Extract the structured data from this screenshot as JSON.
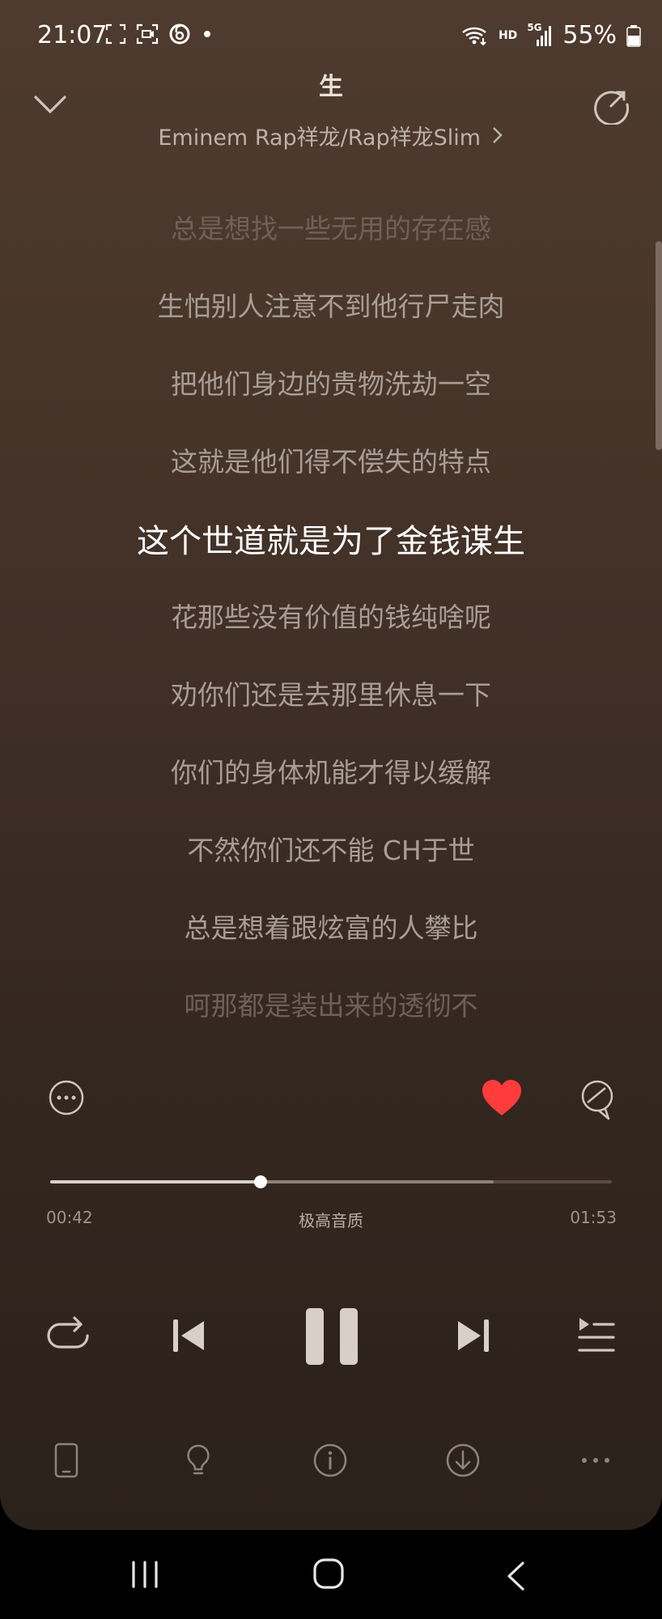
{
  "status_bar": {
    "time": "21:07",
    "network_label": "HD",
    "network_type": "5G",
    "battery": "55%"
  },
  "header": {
    "song_title": "生",
    "artist": "Eminem Rap祥龙/Rap祥龙Slim",
    "icons": [
      "chevron-down-icon",
      "share-icon"
    ]
  },
  "lyrics": [
    "总是想找一些无用的存在感",
    "生怕别人注意不到他行尸走肉",
    "把他们身边的贵物洗劫一空",
    "这就是他们得不偿失的特点",
    "这个世道就是为了金钱谋生",
    "花那些没有价值的钱纯啥呢",
    "劝你们还是去那里休息一下",
    "你们的身体机能才得以缓解",
    "不然你们还不能 CH于世",
    "总是想着跟炫富的人攀比",
    "呵那都是装出来的透彻不"
  ],
  "current_lyric_index": 4,
  "player": {
    "elapsed": "00:42",
    "total": "01:53",
    "quality": "极高音质",
    "progress_fraction": 0.375,
    "buffer_fraction": 0.79,
    "liked": true,
    "like_color": "#ff3b3b"
  },
  "controls": [
    "repeat-icon",
    "previous-icon",
    "pause-icon",
    "next-icon",
    "playlist-icon"
  ],
  "toolbar": [
    "phone-icon",
    "lightbulb-icon",
    "info-icon",
    "download-icon",
    "more-dots-icon"
  ],
  "nav": [
    "recent-apps-icon",
    "home-icon",
    "back-icon"
  ]
}
